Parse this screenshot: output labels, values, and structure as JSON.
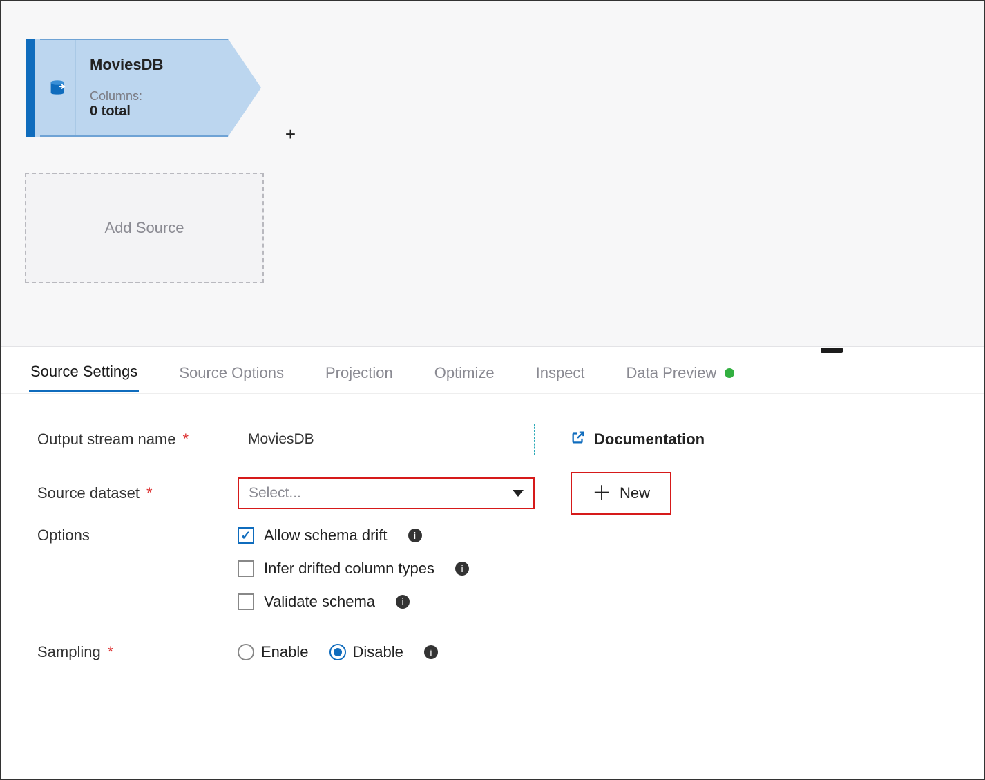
{
  "sourceNode": {
    "title": "MoviesDB",
    "columnsLabel": "Columns:",
    "columnsValue": "0 total"
  },
  "addSource": "Add Source",
  "tabs": [
    "Source Settings",
    "Source Options",
    "Projection",
    "Optimize",
    "Inspect",
    "Data Preview"
  ],
  "form": {
    "outputStreamLabel": "Output stream name",
    "outputStreamValue": "MoviesDB",
    "sourceDatasetLabel": "Source dataset",
    "sourceDatasetPlaceholder": "Select...",
    "newButton": "New",
    "documentation": "Documentation",
    "optionsLabel": "Options",
    "option1": "Allow schema drift",
    "option2": "Infer drifted column types",
    "option3": "Validate schema",
    "samplingLabel": "Sampling",
    "enable": "Enable",
    "disable": "Disable"
  }
}
